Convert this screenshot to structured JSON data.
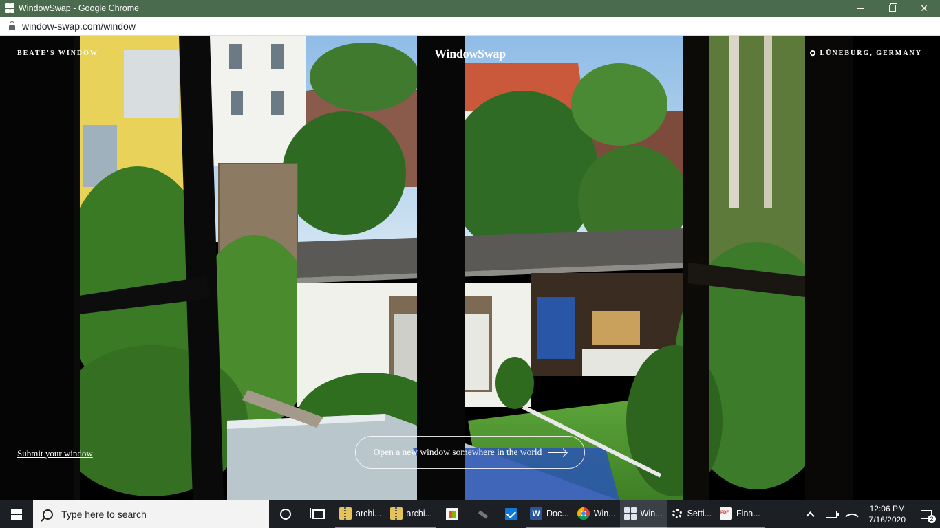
{
  "window": {
    "title": "WindowSwap - Google Chrome"
  },
  "browser": {
    "url": "window-swap.com/window"
  },
  "page": {
    "window_name": "BEATE'S WINDOW",
    "logo": "WindowSwap",
    "location": "LÜNEBURG, GERMANY",
    "submit_link": "Submit your window",
    "open_button": "Open a new window somewhere in the world"
  },
  "taskbar": {
    "search_placeholder": "Type here to search",
    "apps": [
      {
        "label": "archi...",
        "icon": "zip-folder-icon"
      },
      {
        "label": "archi...",
        "icon": "zip-folder-icon"
      },
      {
        "label": "",
        "icon": "store-icon"
      },
      {
        "label": "",
        "icon": "tool-icon"
      },
      {
        "label": "",
        "icon": "mail-icon"
      },
      {
        "label": "Doc...",
        "icon": "word-icon"
      },
      {
        "label": "Win...",
        "icon": "chrome-icon"
      },
      {
        "label": "Win...",
        "icon": "windowswap-icon"
      },
      {
        "label": "Setti...",
        "icon": "gear-icon"
      },
      {
        "label": "Fina...",
        "icon": "pdf-icon"
      }
    ],
    "word_letter": "W",
    "time": "12:06 PM",
    "date": "7/16/2020",
    "notification_count": "2"
  },
  "colors": {
    "title_bar": "#4a6b4e",
    "taskbar": "#1c1f24",
    "active_app_underline": "#8ab4f8"
  }
}
